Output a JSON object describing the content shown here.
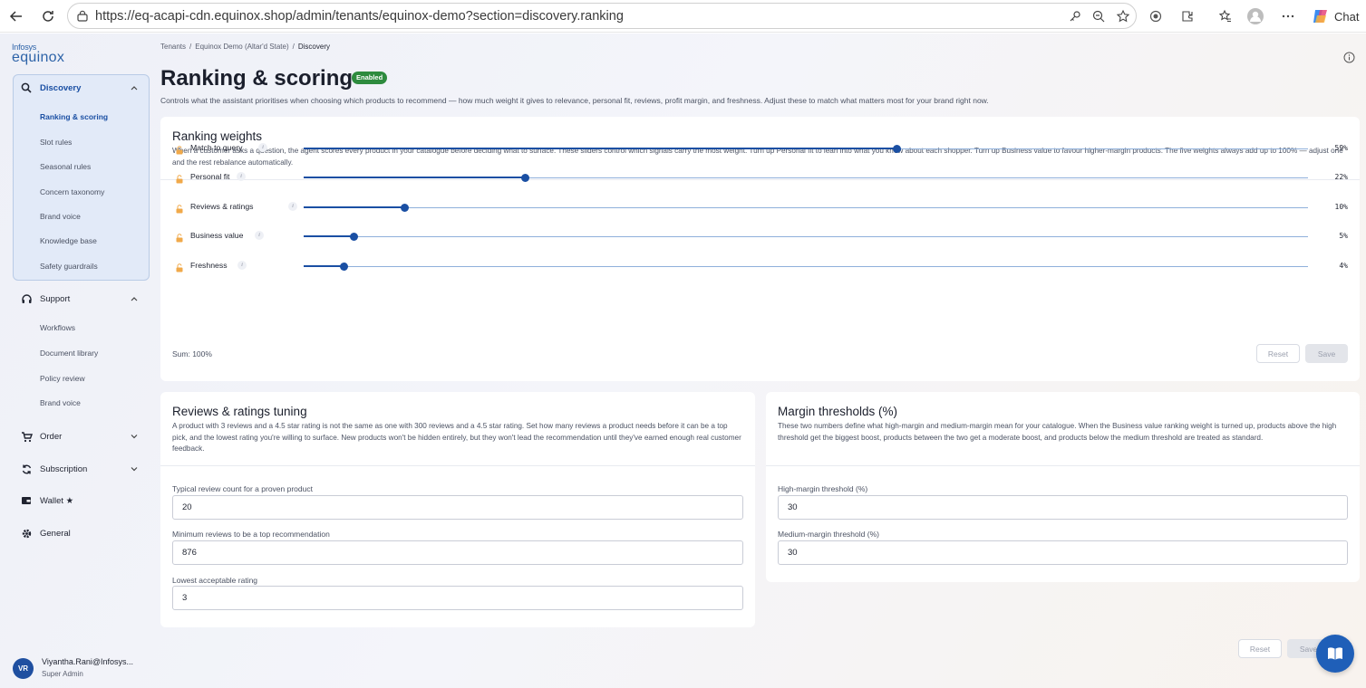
{
  "browser": {
    "url": "https://eq-acapi-cdn.equinox.shop/admin/tenants/equinox-demo?section=discovery.ranking",
    "chat_label": "Chat"
  },
  "sidebar": {
    "logo_small": "Infosys",
    "logo_big": "equinox",
    "discovery": {
      "label": "Discovery",
      "items": [
        "Ranking & scoring",
        "Slot rules",
        "Seasonal rules",
        "Concern taxonomy",
        "Brand voice",
        "Knowledge base",
        "Safety guardrails"
      ]
    },
    "support": {
      "label": "Support",
      "items": [
        "Workflows",
        "Document library",
        "Policy review",
        "Brand voice"
      ]
    },
    "order_label": "Order",
    "subscription_label": "Subscription",
    "wallet_label": "Wallet ★",
    "general_label": "General",
    "user": {
      "initials": "VR",
      "name": "Viyantha.Rani@Infosys...",
      "role": "Super Admin"
    }
  },
  "breadcrumb": [
    "Tenants",
    "Equinox Demo (Altar'd State)",
    "Discovery"
  ],
  "page": {
    "title": "Ranking & scoring",
    "badge": "Enabled",
    "description": "Controls what the assistant prioritises when choosing which products to recommend — how much weight it gives to relevance, personal fit, reviews, profit margin, and freshness. Adjust these to match what matters most for your brand right now."
  },
  "ranking_weights": {
    "title": "Ranking weights",
    "description": "When a customer asks a question, the agent scores every product in your catalogue before deciding what to surface. These sliders control which signals carry the most weight. Turn up Personal fit to lean into what you know about each shopper. Turn up Business value to favour higher-margin products. The five weights always add up to 100% — adjust one and the rest rebalance automatically.",
    "info_glyph": "i",
    "weights": [
      {
        "label": "Match to query",
        "value": 59,
        "display": "59%"
      },
      {
        "label": "Personal fit",
        "value": 22,
        "display": "22%"
      },
      {
        "label": "Reviews & ratings",
        "value": 10,
        "display": "10%"
      },
      {
        "label": "Business value",
        "value": 5,
        "display": "5%"
      },
      {
        "label": "Freshness",
        "value": 4,
        "display": "4%"
      }
    ],
    "sum_text": "Sum: 100%",
    "reset_label": "Reset",
    "save_label": "Save"
  },
  "reviews_tuning": {
    "title": "Reviews & ratings tuning",
    "description": "A product with 3 reviews and a 4.5 star rating is not the same as one with 300 reviews and a 4.5 star rating. Set how many reviews a product needs before it can be a top pick, and the lowest rating you're willing to surface. New products won't be hidden entirely, but they won't lead the recommendation until they've earned enough real customer feedback.",
    "fields": [
      {
        "label": "Typical review count for a proven product",
        "value": "20"
      },
      {
        "label": "Minimum reviews to be a top recommendation",
        "value": "876"
      },
      {
        "label": "Lowest acceptable rating",
        "value": "3"
      }
    ]
  },
  "margin_thresholds": {
    "title": "Margin thresholds (%)",
    "description": "These two numbers define what high-margin and medium-margin mean for your catalogue. When the Business value ranking weight is turned up, products above the high threshold get the biggest boost, products between the two get a moderate boost, and products below the medium threshold are treated as standard.",
    "fields": [
      {
        "label": "High-margin threshold (%)",
        "value": "30"
      },
      {
        "label": "Medium-margin threshold (%)",
        "value": "30"
      }
    ]
  },
  "footer": {
    "reset_label": "Reset",
    "save_label": "Save"
  },
  "colors": {
    "accent": "#1a4fa3",
    "enabled_badge": "#2e8b3e",
    "sidebar_active_bg": "#e2eaf8"
  }
}
